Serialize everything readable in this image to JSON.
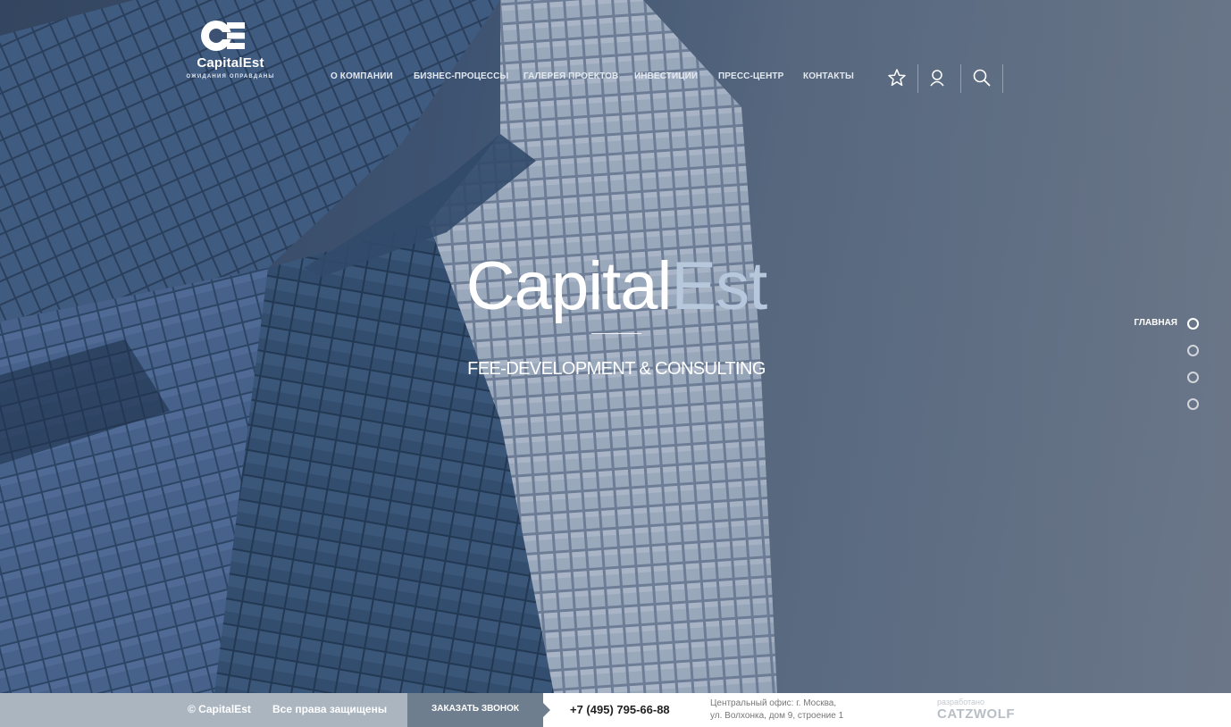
{
  "brand": {
    "name": "CapitalEst",
    "tagline": "ОЖИДАНИЯ ОПРАВДАНЫ"
  },
  "nav": {
    "items": [
      {
        "label": "О КОМПАНИИ"
      },
      {
        "label": "БИЗНЕС-ПРОЦЕССЫ"
      },
      {
        "label": "ГАЛЕРЕЯ ПРОЕКТОВ"
      },
      {
        "label": "ИНВЕСТИЦИИ"
      },
      {
        "label": "ПРЕСС-ЦЕНТР"
      },
      {
        "label": "КОНТАКТЫ"
      }
    ],
    "icons": [
      "star-icon",
      "user-icon",
      "search-icon"
    ]
  },
  "hero": {
    "title_main": "Capital",
    "title_accent": "Est",
    "subtitle": "FEE-DEVELOPMENT & CONSULTING"
  },
  "slides": {
    "active_label": "ГЛАВНАЯ",
    "count": 4,
    "active_index": 0
  },
  "footer": {
    "copyright": "© CapitalEst",
    "rights": "Все права защищены",
    "callback_button": "ЗАКАЗАТЬ ЗВОНОК",
    "phone": "+7 (495) 795-66-88",
    "address_line1": "Центральный офис: г. Москва,",
    "address_line2": "ул. Волхонка, дом 9, строение 1",
    "developer_label": "разработано",
    "developer_name": "CATZWOLF"
  },
  "colors": {
    "accent": "#b8c8dc",
    "footer_left": "#aab5c0",
    "footer_button": "#6f7e8e",
    "hero_overlay": "#3e5371"
  }
}
